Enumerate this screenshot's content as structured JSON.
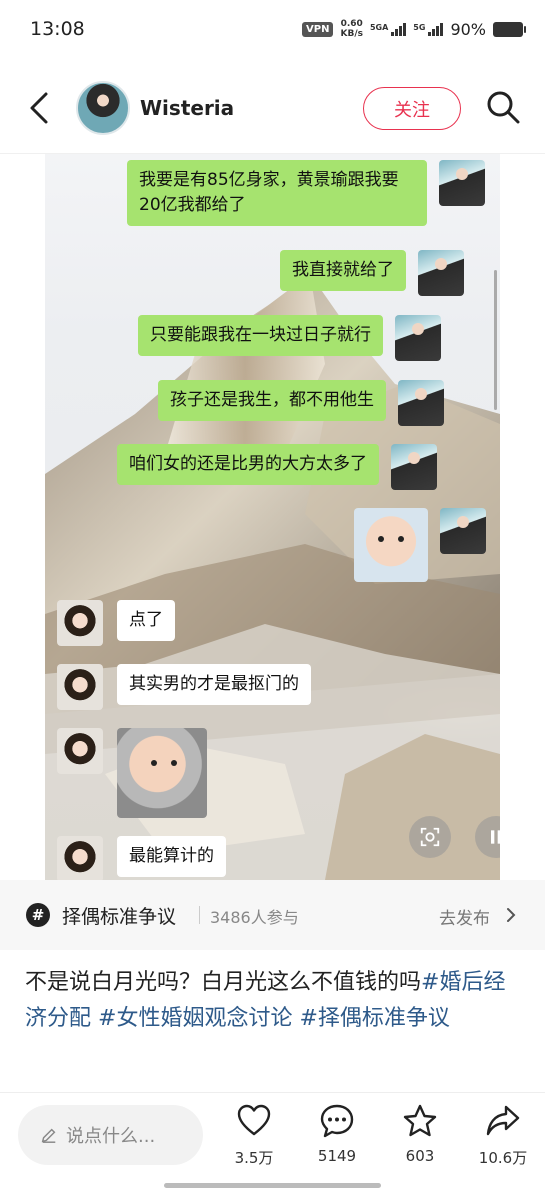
{
  "status_bar": {
    "time": "13:08",
    "vpn": "VPN",
    "net_speed_value": "0.60",
    "net_speed_unit": "KB/s",
    "sig1_label": "5GA",
    "sig2_label": "5G",
    "battery": "90%"
  },
  "header": {
    "author": "Wisteria",
    "follow_label": "关注"
  },
  "chat": {
    "right_messages": [
      "我要是有85亿身家，黄景瑜跟我要20亿我都给了",
      "我直接就给了",
      "只要能跟我在一块过日子就行",
      "孩子还是我生，都不用他生",
      "咱们女的还是比男的大方太多了"
    ],
    "left_messages": [
      "点了",
      "其实男的才是最抠门的",
      "最能算计的"
    ]
  },
  "topic": {
    "icon": "#",
    "name": "择偶标准争议",
    "participants": "3486人参与",
    "action": "去发布"
  },
  "caption": {
    "text": "不是说白月光吗？白月光这么不值钱的吗",
    "tags": [
      "#婚后经济分配",
      "#女性婚姻观念讨论",
      "#择偶标准争议"
    ]
  },
  "bottom": {
    "comment_placeholder": "说点什么...",
    "likes": "3.5万",
    "comments": "5149",
    "favorites": "603",
    "shares": "10.6万"
  },
  "icons": {
    "back": "back-arrow-icon",
    "search": "search-icon",
    "like": "heart-icon",
    "comment": "comment-bubble-icon",
    "favorite": "star-icon",
    "share": "share-arrow-icon",
    "pencil": "pencil-icon",
    "pause": "pause-icon",
    "screenshot": "scan-icon"
  },
  "colors": {
    "accent": "#e8324f",
    "bubble_green": "#a6e36f",
    "tag_blue": "#2e5a8a"
  }
}
